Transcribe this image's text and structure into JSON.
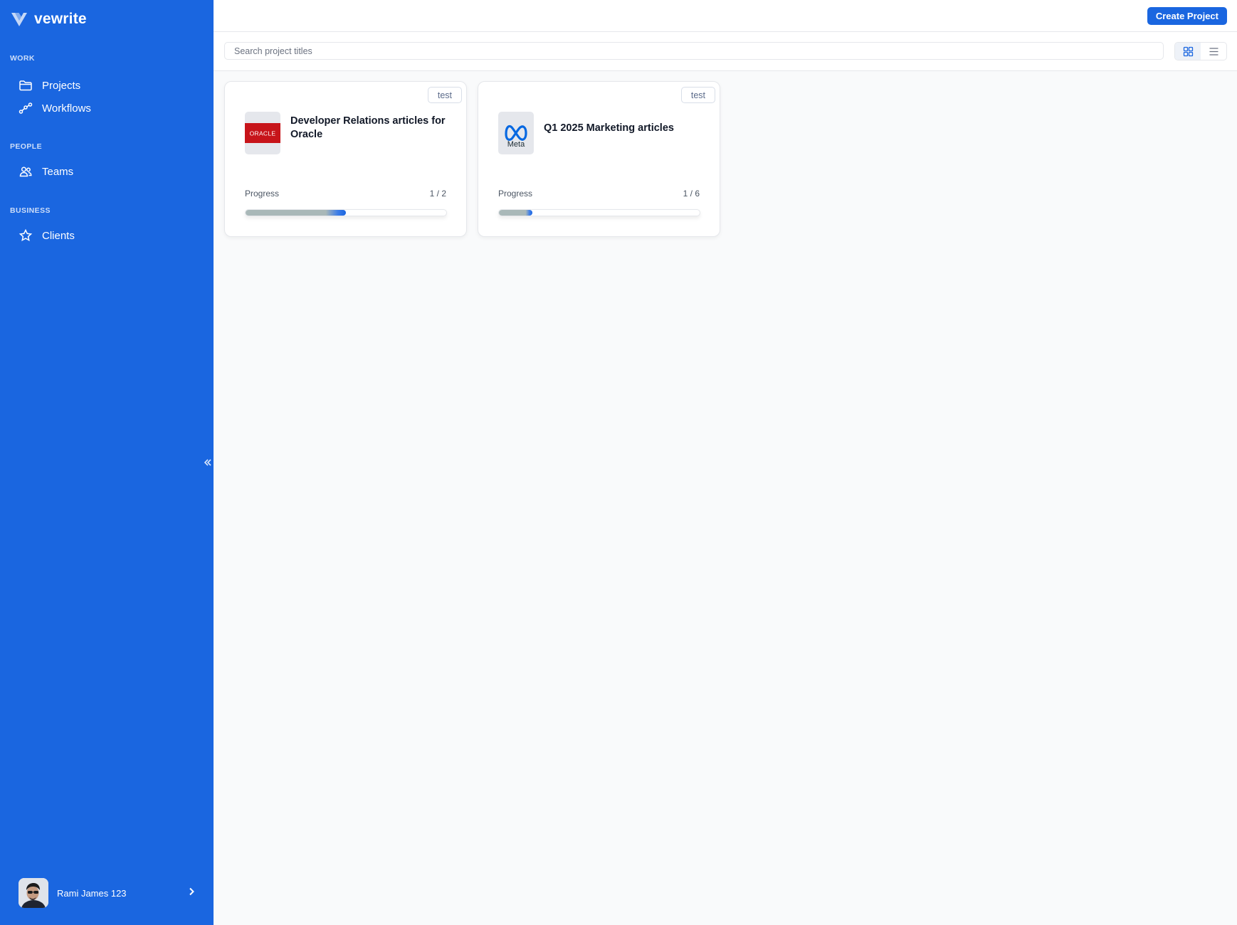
{
  "app": {
    "name": "vewrite"
  },
  "sidebar": {
    "sections": [
      {
        "label": "WORK",
        "items": [
          {
            "label": "Projects",
            "icon": "folder-icon"
          },
          {
            "label": "Workflows",
            "icon": "workflow-icon"
          }
        ]
      },
      {
        "label": "PEOPLE",
        "items": [
          {
            "label": "Teams",
            "icon": "users-icon"
          }
        ]
      },
      {
        "label": "BUSINESS",
        "items": [
          {
            "label": "Clients",
            "icon": "star-icon"
          }
        ]
      }
    ],
    "user": {
      "name": "Rami James 123"
    }
  },
  "header": {
    "create_label": "Create Project"
  },
  "search": {
    "placeholder": "Search project titles"
  },
  "view_toggle": {
    "active": "grid",
    "options": [
      "grid",
      "list"
    ]
  },
  "colors": {
    "brand": "#1a66e0",
    "oracle_red": "#c7141a",
    "meta_blue": "#0668e1"
  },
  "projects": [
    {
      "tag": "test",
      "title": "Developer Relations articles for Oracle",
      "client_logo_text": "ORACLE",
      "progress_label": "Progress",
      "progress_text": "1 / 2",
      "progress_value": 0.5
    },
    {
      "tag": "test",
      "title": "Q1 2025 Marketing articles",
      "client_logo_text": "Meta",
      "progress_label": "Progress",
      "progress_text": "1 / 6",
      "progress_value": 0.1667
    }
  ]
}
